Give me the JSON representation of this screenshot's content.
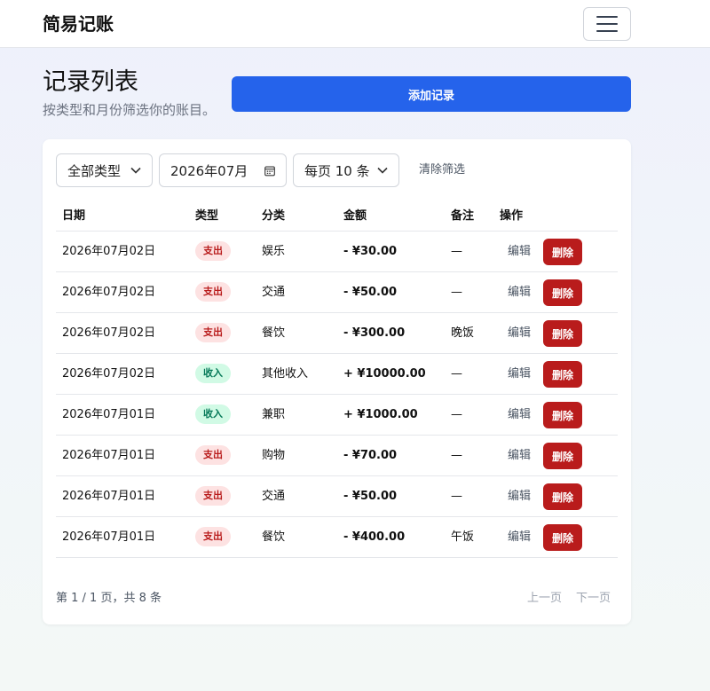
{
  "app": {
    "brand": "简易记账"
  },
  "header": {
    "title": "记录列表",
    "subtitle": "按类型和月份筛选你的账目。",
    "add_label": "添加记录"
  },
  "filters": {
    "type_value": "全部类型",
    "month_value": "2026年07月",
    "page_size_value": "每页 10 条",
    "clear_label": "清除筛选"
  },
  "table": {
    "columns": [
      "日期",
      "类型",
      "分类",
      "金额",
      "备注",
      "操作"
    ],
    "edit_label": "编辑",
    "delete_label": "删除",
    "rows": [
      {
        "date": "2026年07月02日",
        "type": "支出",
        "kind": "expense",
        "category": "娱乐",
        "amount": "- ¥30.00",
        "note": "—"
      },
      {
        "date": "2026年07月02日",
        "type": "支出",
        "kind": "expense",
        "category": "交通",
        "amount": "- ¥50.00",
        "note": "—"
      },
      {
        "date": "2026年07月02日",
        "type": "支出",
        "kind": "expense",
        "category": "餐饮",
        "amount": "- ¥300.00",
        "note": "晚饭"
      },
      {
        "date": "2026年07月02日",
        "type": "收入",
        "kind": "income",
        "category": "其他收入",
        "amount": "+ ¥10000.00",
        "note": "—"
      },
      {
        "date": "2026年07月01日",
        "type": "收入",
        "kind": "income",
        "category": "兼职",
        "amount": "+ ¥1000.00",
        "note": "—"
      },
      {
        "date": "2026年07月01日",
        "type": "支出",
        "kind": "expense",
        "category": "购物",
        "amount": "- ¥70.00",
        "note": "—"
      },
      {
        "date": "2026年07月01日",
        "type": "支出",
        "kind": "expense",
        "category": "交通",
        "amount": "- ¥50.00",
        "note": "—"
      },
      {
        "date": "2026年07月01日",
        "type": "支出",
        "kind": "expense",
        "category": "餐饮",
        "amount": "- ¥400.00",
        "note": "午饭"
      }
    ]
  },
  "pagination": {
    "info": "第 1 / 1 页，共 8 条",
    "prev_label": "上一页",
    "next_label": "下一页"
  },
  "colors": {
    "primary": "#2563eb",
    "danger": "#b91c1c",
    "expense_badge_bg": "#fde2e2",
    "income_badge_bg": "#d1fae5"
  },
  "icons": [
    "menu-icon",
    "chevron-down-icon",
    "calendar-icon"
  ]
}
